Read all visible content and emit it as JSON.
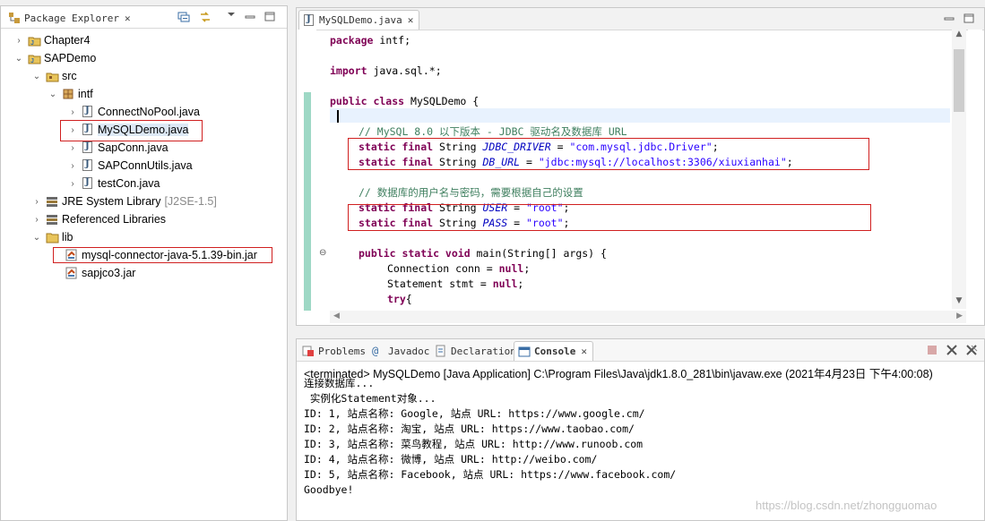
{
  "package_explorer": {
    "title": "Package Explorer",
    "items": [
      {
        "label": "Chapter4",
        "suffix": ""
      },
      {
        "label": "SAPDemo",
        "suffix": ""
      },
      {
        "label": "src",
        "suffix": ""
      },
      {
        "label": "intf",
        "suffix": ""
      },
      {
        "label": "ConnectNoPool.java",
        "suffix": ""
      },
      {
        "label": "MySQLDemo.java",
        "suffix": ""
      },
      {
        "label": "SapConn.java",
        "suffix": ""
      },
      {
        "label": "SAPConnUtils.java",
        "suffix": ""
      },
      {
        "label": "testCon.java",
        "suffix": ""
      },
      {
        "label": "JRE System Library",
        "suffix": "[J2SE-1.5]"
      },
      {
        "label": "Referenced Libraries",
        "suffix": ""
      },
      {
        "label": "lib",
        "suffix": ""
      },
      {
        "label": "mysql-connector-java-5.1.39-bin.jar",
        "suffix": ""
      },
      {
        "label": "sapjco3.jar",
        "suffix": ""
      }
    ]
  },
  "editor": {
    "tab": "MySQLDemo.java",
    "lines": {
      "l1": {
        "kw": "package",
        "rest": " intf;"
      },
      "l2": {
        "kw": "import",
        "rest": " java.sql.*;"
      },
      "l3": {
        "kw": "public class",
        "rest": " MySQLDemo {"
      },
      "l4": {
        "comment": "// MySQL 8.0 以下版本 - JDBC 驱动名及数据库 URL"
      },
      "l5": {
        "kw": "static final",
        "type": " String ",
        "field": "JDBC_DRIVER",
        "eq": " = ",
        "str": "\"com.mysql.jdbc.Driver\"",
        "end": ";"
      },
      "l6": {
        "kw": "static final",
        "type": " String ",
        "field": "DB_URL",
        "eq": " = ",
        "str": "\"jdbc:mysql://localhost:3306/xiuxianhai\"",
        "end": ";"
      },
      "l7": {
        "comment": "// 数据库的用户名与密码，需要根据自己的设置"
      },
      "l8": {
        "kw": "static final",
        "type": " String ",
        "field": "USER",
        "eq": " = ",
        "str": "\"root\"",
        "end": ";"
      },
      "l9": {
        "kw": "static final",
        "type": " String ",
        "field": "PASS",
        "eq": " = ",
        "str": "\"root\"",
        "end": ";"
      },
      "l10": {
        "kw": "public static void",
        "rest": " main(String[] args) {"
      },
      "l11": {
        "pre": "Connection conn = ",
        "kw": "null",
        "end": ";"
      },
      "l12": {
        "pre": "Statement stmt = ",
        "kw": "null",
        "end": ";"
      },
      "l13": {
        "kw": "try",
        "rest": "{"
      }
    }
  },
  "console_panel": {
    "tabs": [
      "Problems",
      "Javadoc",
      "Declaration",
      "Console"
    ],
    "status": "<terminated> MySQLDemo [Java Application] C:\\Program Files\\Java\\jdk1.8.0_281\\bin\\javaw.exe (2021年4月23日 下午4:00:08)",
    "output": [
      "连接数据库...",
      " 实例化Statement对象...",
      "ID: 1, 站点名称: Google, 站点 URL: https://www.google.cm/",
      "ID: 2, 站点名称: 淘宝, 站点 URL: https://www.taobao.com/",
      "ID: 3, 站点名称: 菜鸟教程, 站点 URL: http://www.runoob.com",
      "ID: 4, 站点名称: 微博, 站点 URL: http://weibo.com/",
      "ID: 5, 站点名称: Facebook, 站点 URL: https://www.facebook.com/",
      "Goodbye!"
    ]
  },
  "watermark": "https://blog.csdn.net/zhongguomao",
  "colors": {
    "keyword": "#7f0055",
    "comment": "#3f7f5f",
    "string": "#2a00ff",
    "field": "#0000c0",
    "highlight_box": "#d02020"
  }
}
